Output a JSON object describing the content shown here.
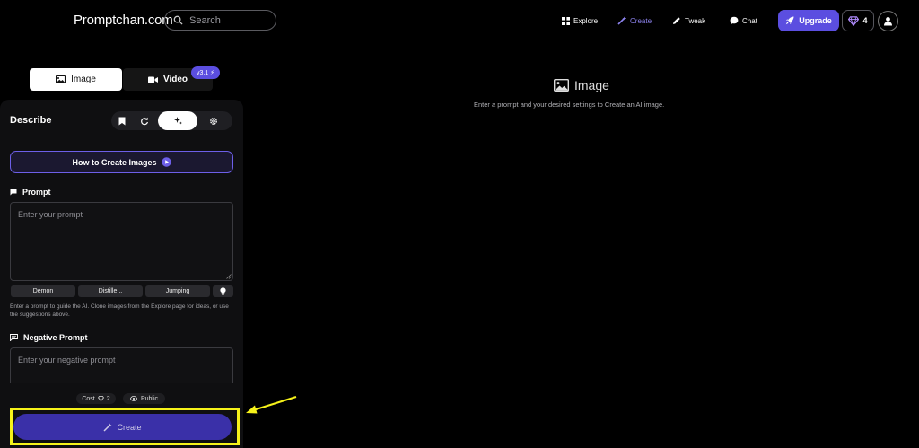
{
  "header": {
    "logo": "Promptchan.com",
    "search_placeholder": "Search",
    "nav": [
      {
        "label": "Explore",
        "icon": "grid-icon"
      },
      {
        "label": "Create",
        "icon": "magic-wand-icon"
      },
      {
        "label": "Tweak",
        "icon": "pencil-icon"
      },
      {
        "label": "Chat",
        "icon": "chat-bubble-icon"
      }
    ],
    "upgrade_label": "Upgrade",
    "gems_count": "4"
  },
  "mode_tabs": {
    "image_label": "Image",
    "video_label": "Video",
    "video_badge": "v3.1 ⚡"
  },
  "panel": {
    "title": "Describe",
    "how_to_label": "How to Create Images",
    "prompt": {
      "label": "Prompt",
      "placeholder": "Enter your prompt",
      "value": ""
    },
    "suggestions": [
      "Demon",
      "Distille...",
      "Jumping"
    ],
    "hint": "Enter a prompt to guide the AI. Clone images from the Explore page for ideas, or use the suggestions above.",
    "negative_prompt": {
      "label": "Negative Prompt",
      "placeholder": "Enter your negative prompt",
      "value": ""
    },
    "cost_label": "Cost",
    "cost_value": "2",
    "visibility_label": "Public",
    "create_label": "Create"
  },
  "main": {
    "title": "Image",
    "subtitle": "Enter a prompt and your desired settings to Create an AI image."
  },
  "colors": {
    "accent": "#5b4ee0",
    "highlight_frame": "#f6f21a",
    "create_button": "#3a30a8"
  }
}
